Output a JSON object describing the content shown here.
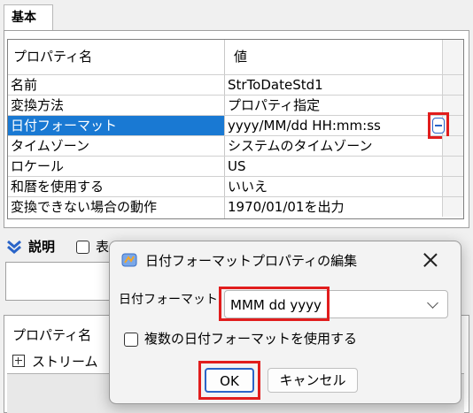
{
  "tab": {
    "label": "基本"
  },
  "grid": {
    "header": {
      "name": "プロパティ名",
      "value": "値"
    },
    "rows": [
      {
        "name": "名前",
        "value": "StrToDateStd1"
      },
      {
        "name": "変換方法",
        "value": "プロパティ指定"
      },
      {
        "name": "日付フォーマット",
        "value": "yyyy/MM/dd HH:mm:ss"
      },
      {
        "name": "タイムゾーン",
        "value": "システムのタイムゾーン"
      },
      {
        "name": "ロケール",
        "value": "US"
      },
      {
        "name": "和暦を使用する",
        "value": "いいえ"
      },
      {
        "name": "変換できない場合の動作",
        "value": "1970/01/01を出力"
      }
    ],
    "selected_row": 2
  },
  "description": {
    "label": "説明",
    "checkbox_label": "表"
  },
  "lower": {
    "header": "プロパティ名",
    "row_label": "ストリーム"
  },
  "dialog": {
    "title": "日付フォーマットプロパティの編集",
    "format_label": "日付フォーマット",
    "format_value": "MMM dd yyyy",
    "multi_checkbox_label": "複数の日付フォーマットを使用する",
    "multi_checked": false,
    "ok_label": "OK",
    "cancel_label": "キャンセル"
  },
  "colors": {
    "selection": "#1979d3",
    "highlight": "#e11d1d",
    "accent": "#2a64c8"
  }
}
